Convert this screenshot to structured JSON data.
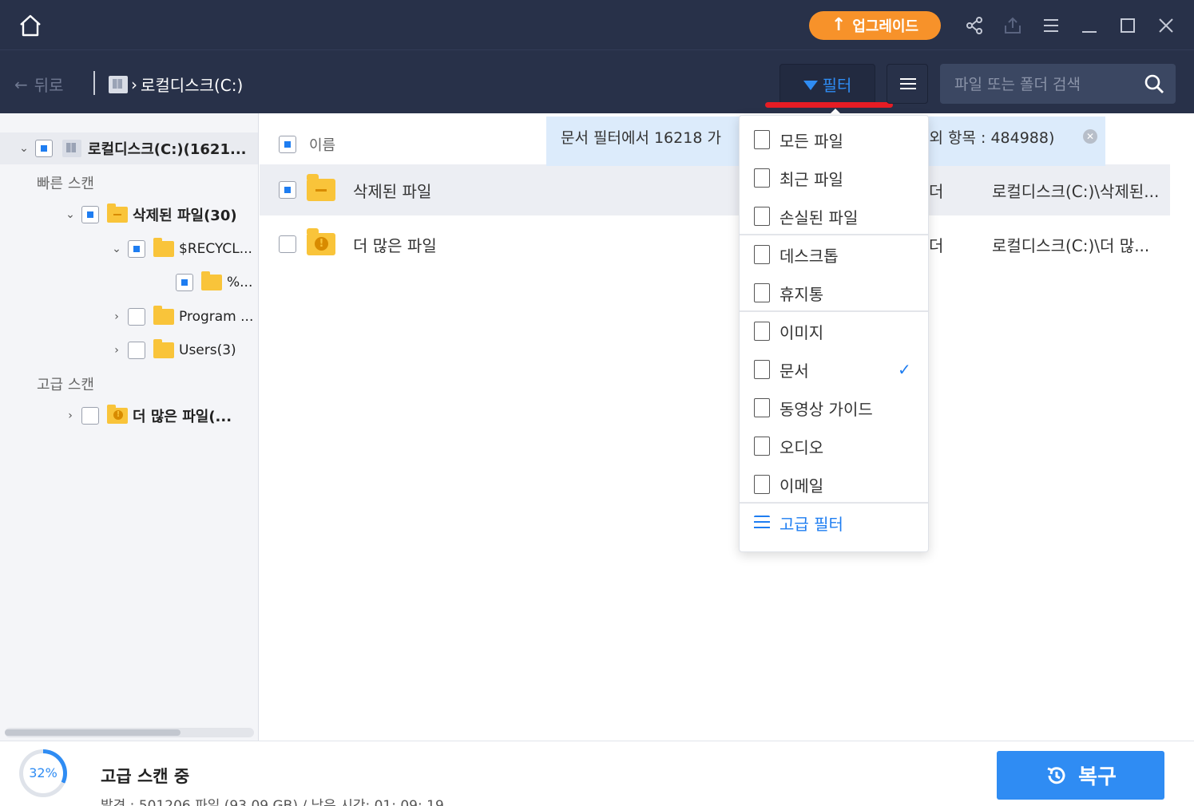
{
  "titlebar": {
    "upgrade_label": "업그레이드",
    "icons": [
      "home-icon",
      "share-icon",
      "export-icon",
      "menu-icon",
      "minimize-icon",
      "maximize-icon",
      "close-icon"
    ]
  },
  "nav": {
    "back_label": "뒤로",
    "breadcrumb": "로컬디스크(C:)",
    "filter_label": "필터",
    "search_placeholder": "파일 또는 폴더 검색"
  },
  "sidebar": {
    "root_label": "로컬디스크(C:)(1621...",
    "quick_scan_label": "빠른 스캔",
    "deleted_files": "삭제된 파일(30)",
    "recycle": "$RECYCL...",
    "percent_folder": "%...",
    "program": "Program ...",
    "users": "Users(3)",
    "advanced_scan_label": "고급 스캔",
    "more_files": "더 많은 파일(..."
  },
  "list": {
    "name_header": "이름",
    "rows": [
      {
        "name": "삭제된 파일",
        "type": "더",
        "path": "로컬디스크(C:)\\삭제된..."
      },
      {
        "name": "더 많은 파일",
        "type": "더",
        "path": "로컬디스크(C:)\\더 많..."
      }
    ]
  },
  "notice": {
    "left": "문서 필터에서 16218 가",
    "right": "제외 항목 : 484988)"
  },
  "filter_menu": {
    "items": [
      {
        "label": "모든 파일",
        "icon": "file-icon"
      },
      {
        "label": "최근 파일",
        "icon": "recent-file-icon"
      },
      {
        "label": "손실된 파일",
        "icon": "lost-file-icon"
      },
      {
        "label": "데스크톱",
        "icon": "desktop-icon"
      },
      {
        "label": "휴지통",
        "icon": "recycle-bin-icon"
      },
      {
        "label": "이미지",
        "icon": "image-icon"
      },
      {
        "label": "문서",
        "icon": "document-icon",
        "checked": true
      },
      {
        "label": "동영상 가이드",
        "icon": "video-icon"
      },
      {
        "label": "오디오",
        "icon": "audio-icon"
      },
      {
        "label": "이메일",
        "icon": "email-icon"
      },
      {
        "label": "고급 필터",
        "icon": "advanced-filter-icon"
      }
    ]
  },
  "status": {
    "progress_label": "32%",
    "progress_fraction": 0.32,
    "title": "고급 스캔 중",
    "detail": "발견 : 501206 파일 (93.09 GB) / 남은 시간: 01: 09: 19",
    "recover_label": "복구"
  },
  "colors": {
    "header_bg": "#283149",
    "accent": "#2f8cf3",
    "upgrade": "#f7922a",
    "highlight": "#e61c24"
  }
}
